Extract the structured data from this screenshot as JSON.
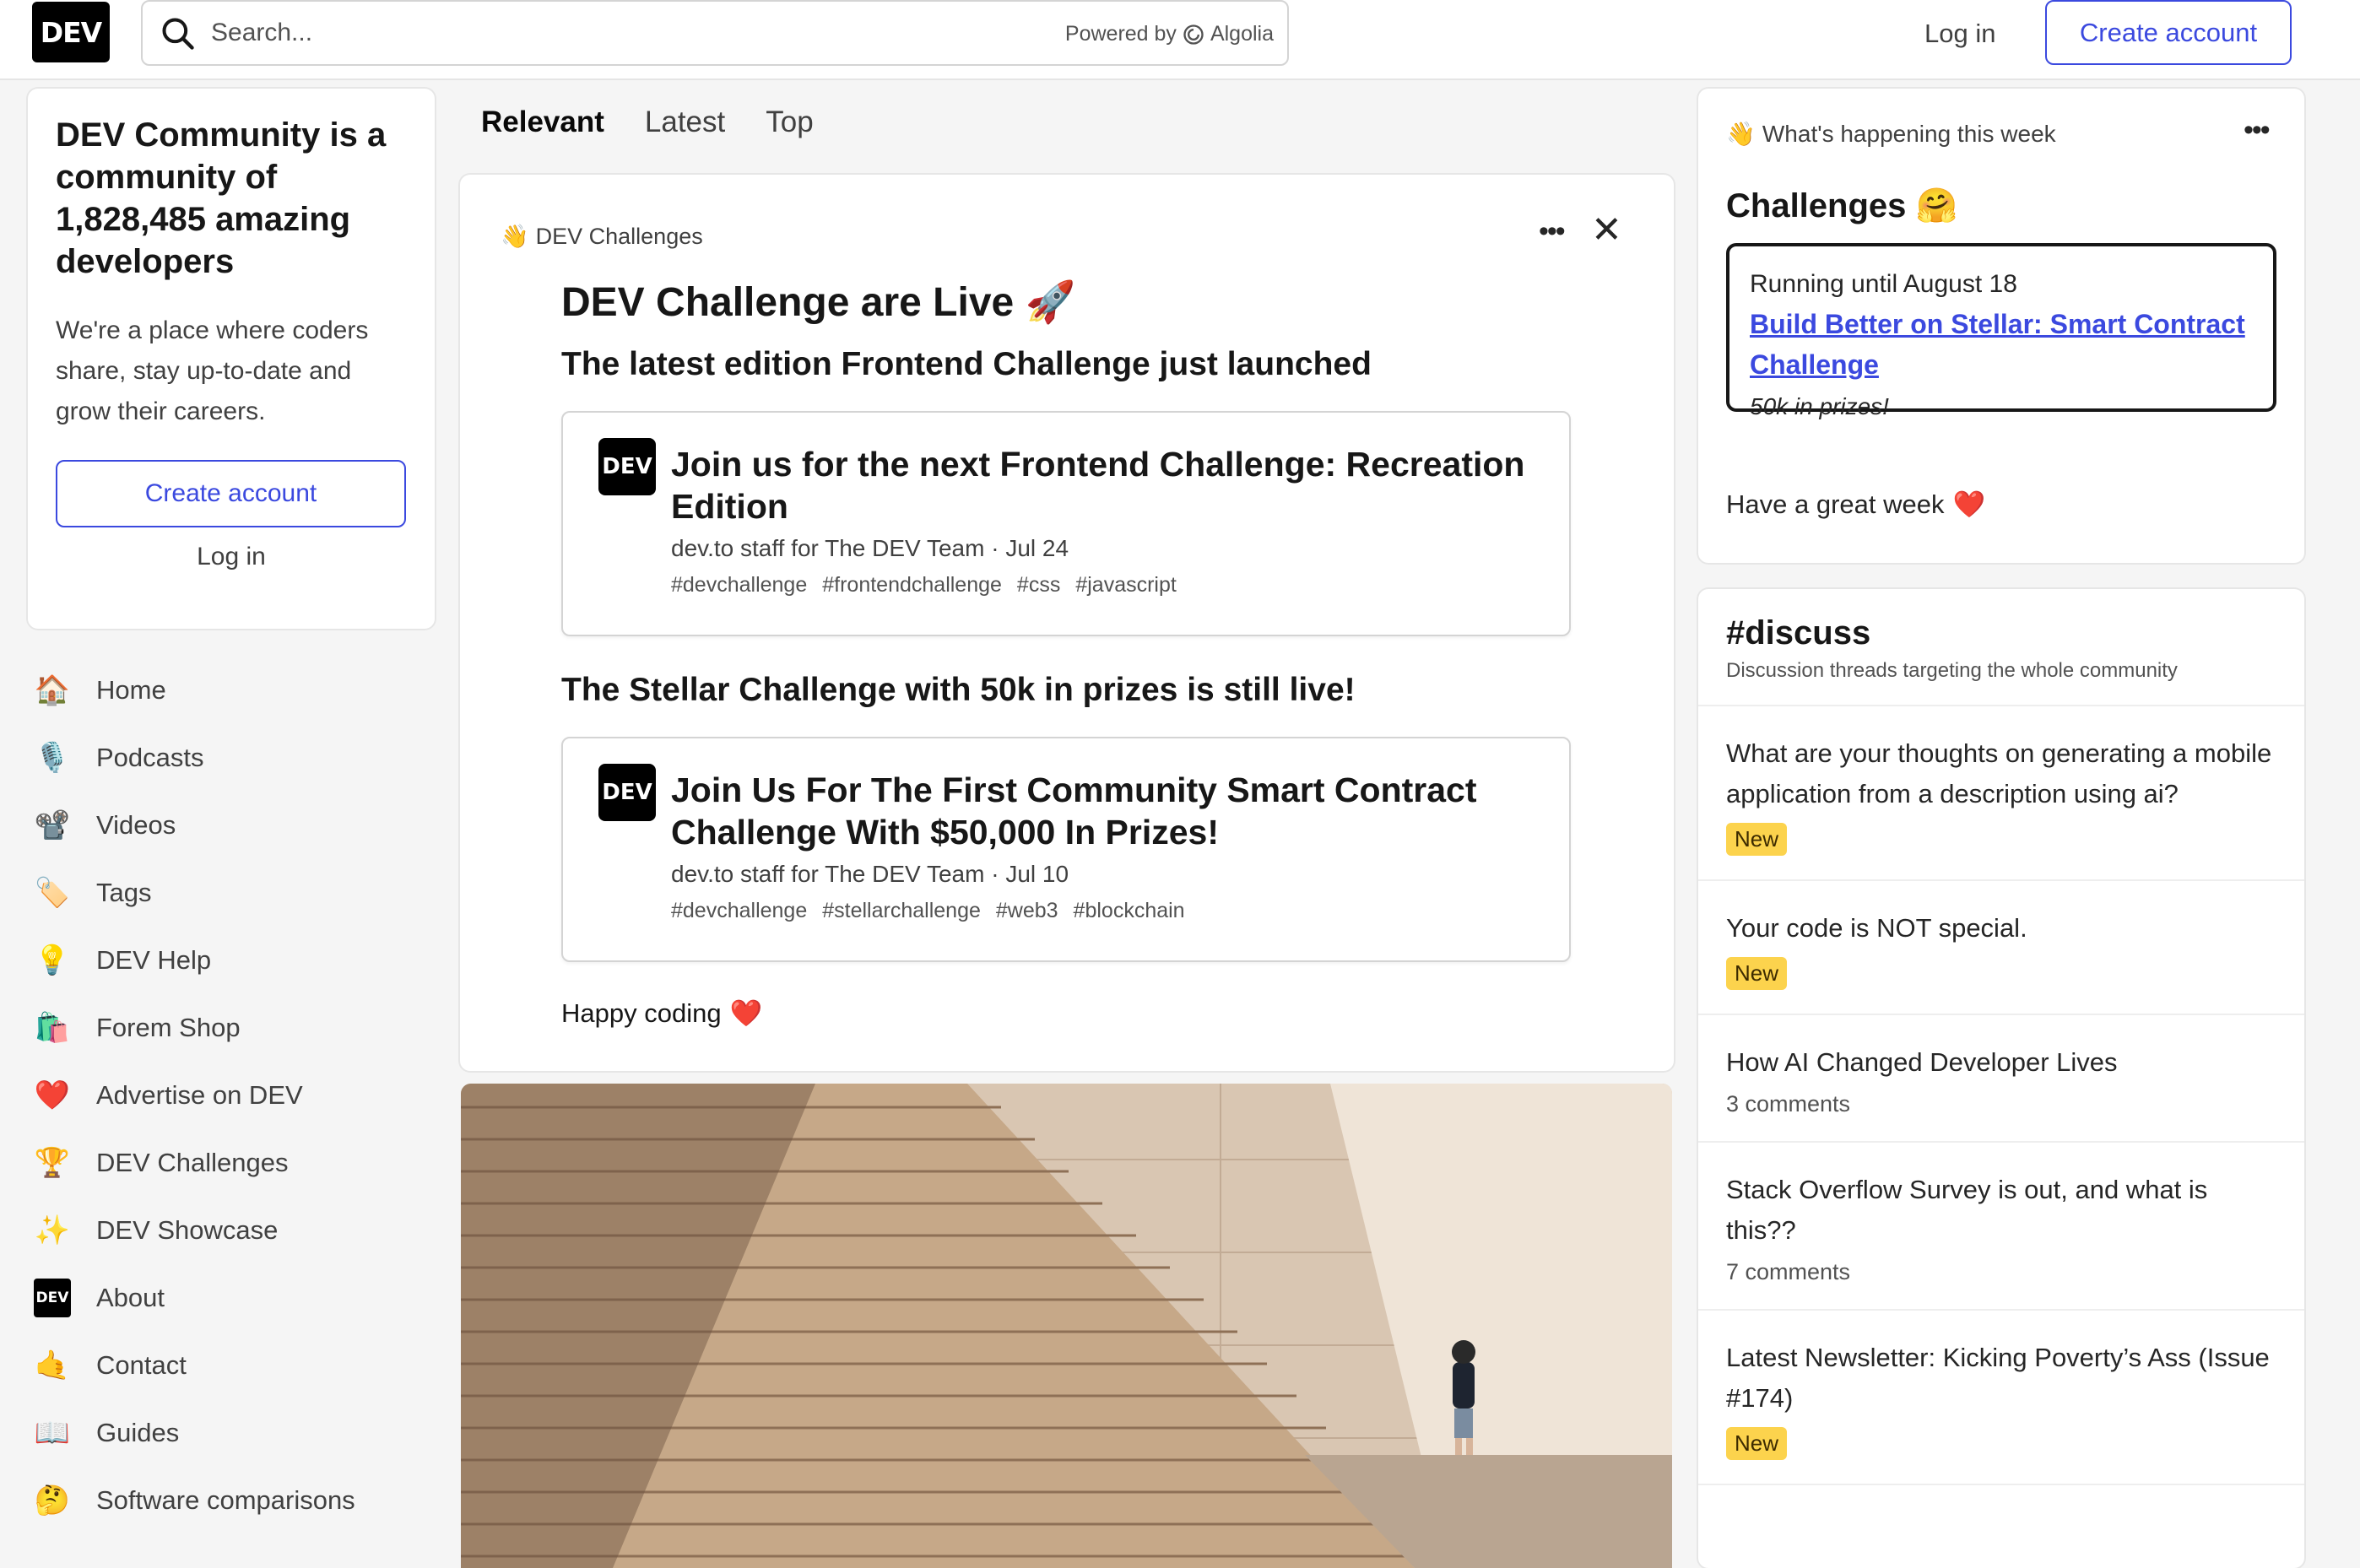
{
  "header": {
    "logo_text": "DEV",
    "search_placeholder": "Search...",
    "powered_by": "Powered by",
    "powered_brand": "Algolia",
    "login": "Log in",
    "create_account": "Create account"
  },
  "intro": {
    "title": "DEV Community is a community of 1,828,485 amazing developers",
    "description": "We're a place where coders share, stay up-to-date and grow their careers.",
    "create_account": "Create account",
    "login": "Log in"
  },
  "nav": {
    "items": [
      {
        "label": "Home",
        "icon": "house-icon",
        "glyph": "🏠"
      },
      {
        "label": "Podcasts",
        "icon": "microphone-icon",
        "glyph": "🎙️"
      },
      {
        "label": "Videos",
        "icon": "movie-camera-icon",
        "glyph": "📽️"
      },
      {
        "label": "Tags",
        "icon": "tag-icon",
        "glyph": "🏷️"
      },
      {
        "label": "DEV Help",
        "icon": "lightbulb-icon",
        "glyph": "💡"
      },
      {
        "label": "Forem Shop",
        "icon": "shopping-bags-icon",
        "glyph": "🛍️"
      },
      {
        "label": "Advertise on DEV",
        "icon": "heart-icon",
        "glyph": "❤️"
      },
      {
        "label": "DEV Challenges",
        "icon": "trophy-icon",
        "glyph": "🏆"
      },
      {
        "label": "DEV Showcase",
        "icon": "sparkles-icon",
        "glyph": "✨"
      },
      {
        "label": "About",
        "icon": "dev-logo-icon",
        "glyph": "DEV"
      },
      {
        "label": "Contact",
        "icon": "contact-icon",
        "glyph": "🤙"
      },
      {
        "label": "Guides",
        "icon": "book-icon",
        "glyph": "📖"
      },
      {
        "label": "Software comparisons",
        "icon": "thinking-face-icon",
        "glyph": "🤔"
      }
    ]
  },
  "feed": {
    "tabs": [
      "Relevant",
      "Latest",
      "Top"
    ],
    "active_tab": "Relevant"
  },
  "challenge_card": {
    "label_emoji": "👋",
    "label": "DEV Challenges",
    "title": "DEV Challenge are Live 🚀",
    "subtitle1": "The latest edition Frontend Challenge just launched",
    "embed1": {
      "title": "Join us for the next Frontend Challenge: Recreation Edition",
      "meta": "dev.to staff for The DEV Team  ·  Jul 24",
      "tags": [
        "#devchallenge",
        "#frontendchallenge",
        "#css",
        "#javascript"
      ]
    },
    "subtitle2": "The Stellar Challenge with 50k in prizes is still live!",
    "embed2": {
      "title": "Join Us For The First Community Smart Contract Challenge With $50,000 In Prizes!",
      "meta": "dev.to staff for The DEV Team  ·  Jul 10",
      "tags": [
        "#devchallenge",
        "#stellarchallenge",
        "#web3",
        "#blockchain"
      ]
    },
    "footer": "Happy coding",
    "footer_emoji": "❤️"
  },
  "week": {
    "label_emoji": "👋",
    "label": "What's happening this week",
    "title": "Challenges 🤗",
    "running": "Running until August 18",
    "link": "Build Better on Stellar: Smart Contract Challenge",
    "prize": "50k in prizes!",
    "footer": "Have a great week",
    "footer_emoji": "❤️"
  },
  "discuss": {
    "title": "#discuss",
    "subtitle": "Discussion threads targeting the whole community",
    "threads": [
      {
        "title": "What are your thoughts on generating a mobile application from a description using ai?",
        "badge": "New"
      },
      {
        "title": "Your code is NOT special.",
        "badge": "New"
      },
      {
        "title": "How AI Changed Developer Lives",
        "comments": "3 comments"
      },
      {
        "title": "Stack Overflow Survey is out, and what is this??",
        "comments": "7 comments"
      },
      {
        "title": "Latest Newsletter: Kicking Poverty’s Ass (Issue #174)",
        "badge": "New"
      }
    ]
  },
  "colors": {
    "brand": "#3b49df",
    "badge": "#fcd34d"
  }
}
